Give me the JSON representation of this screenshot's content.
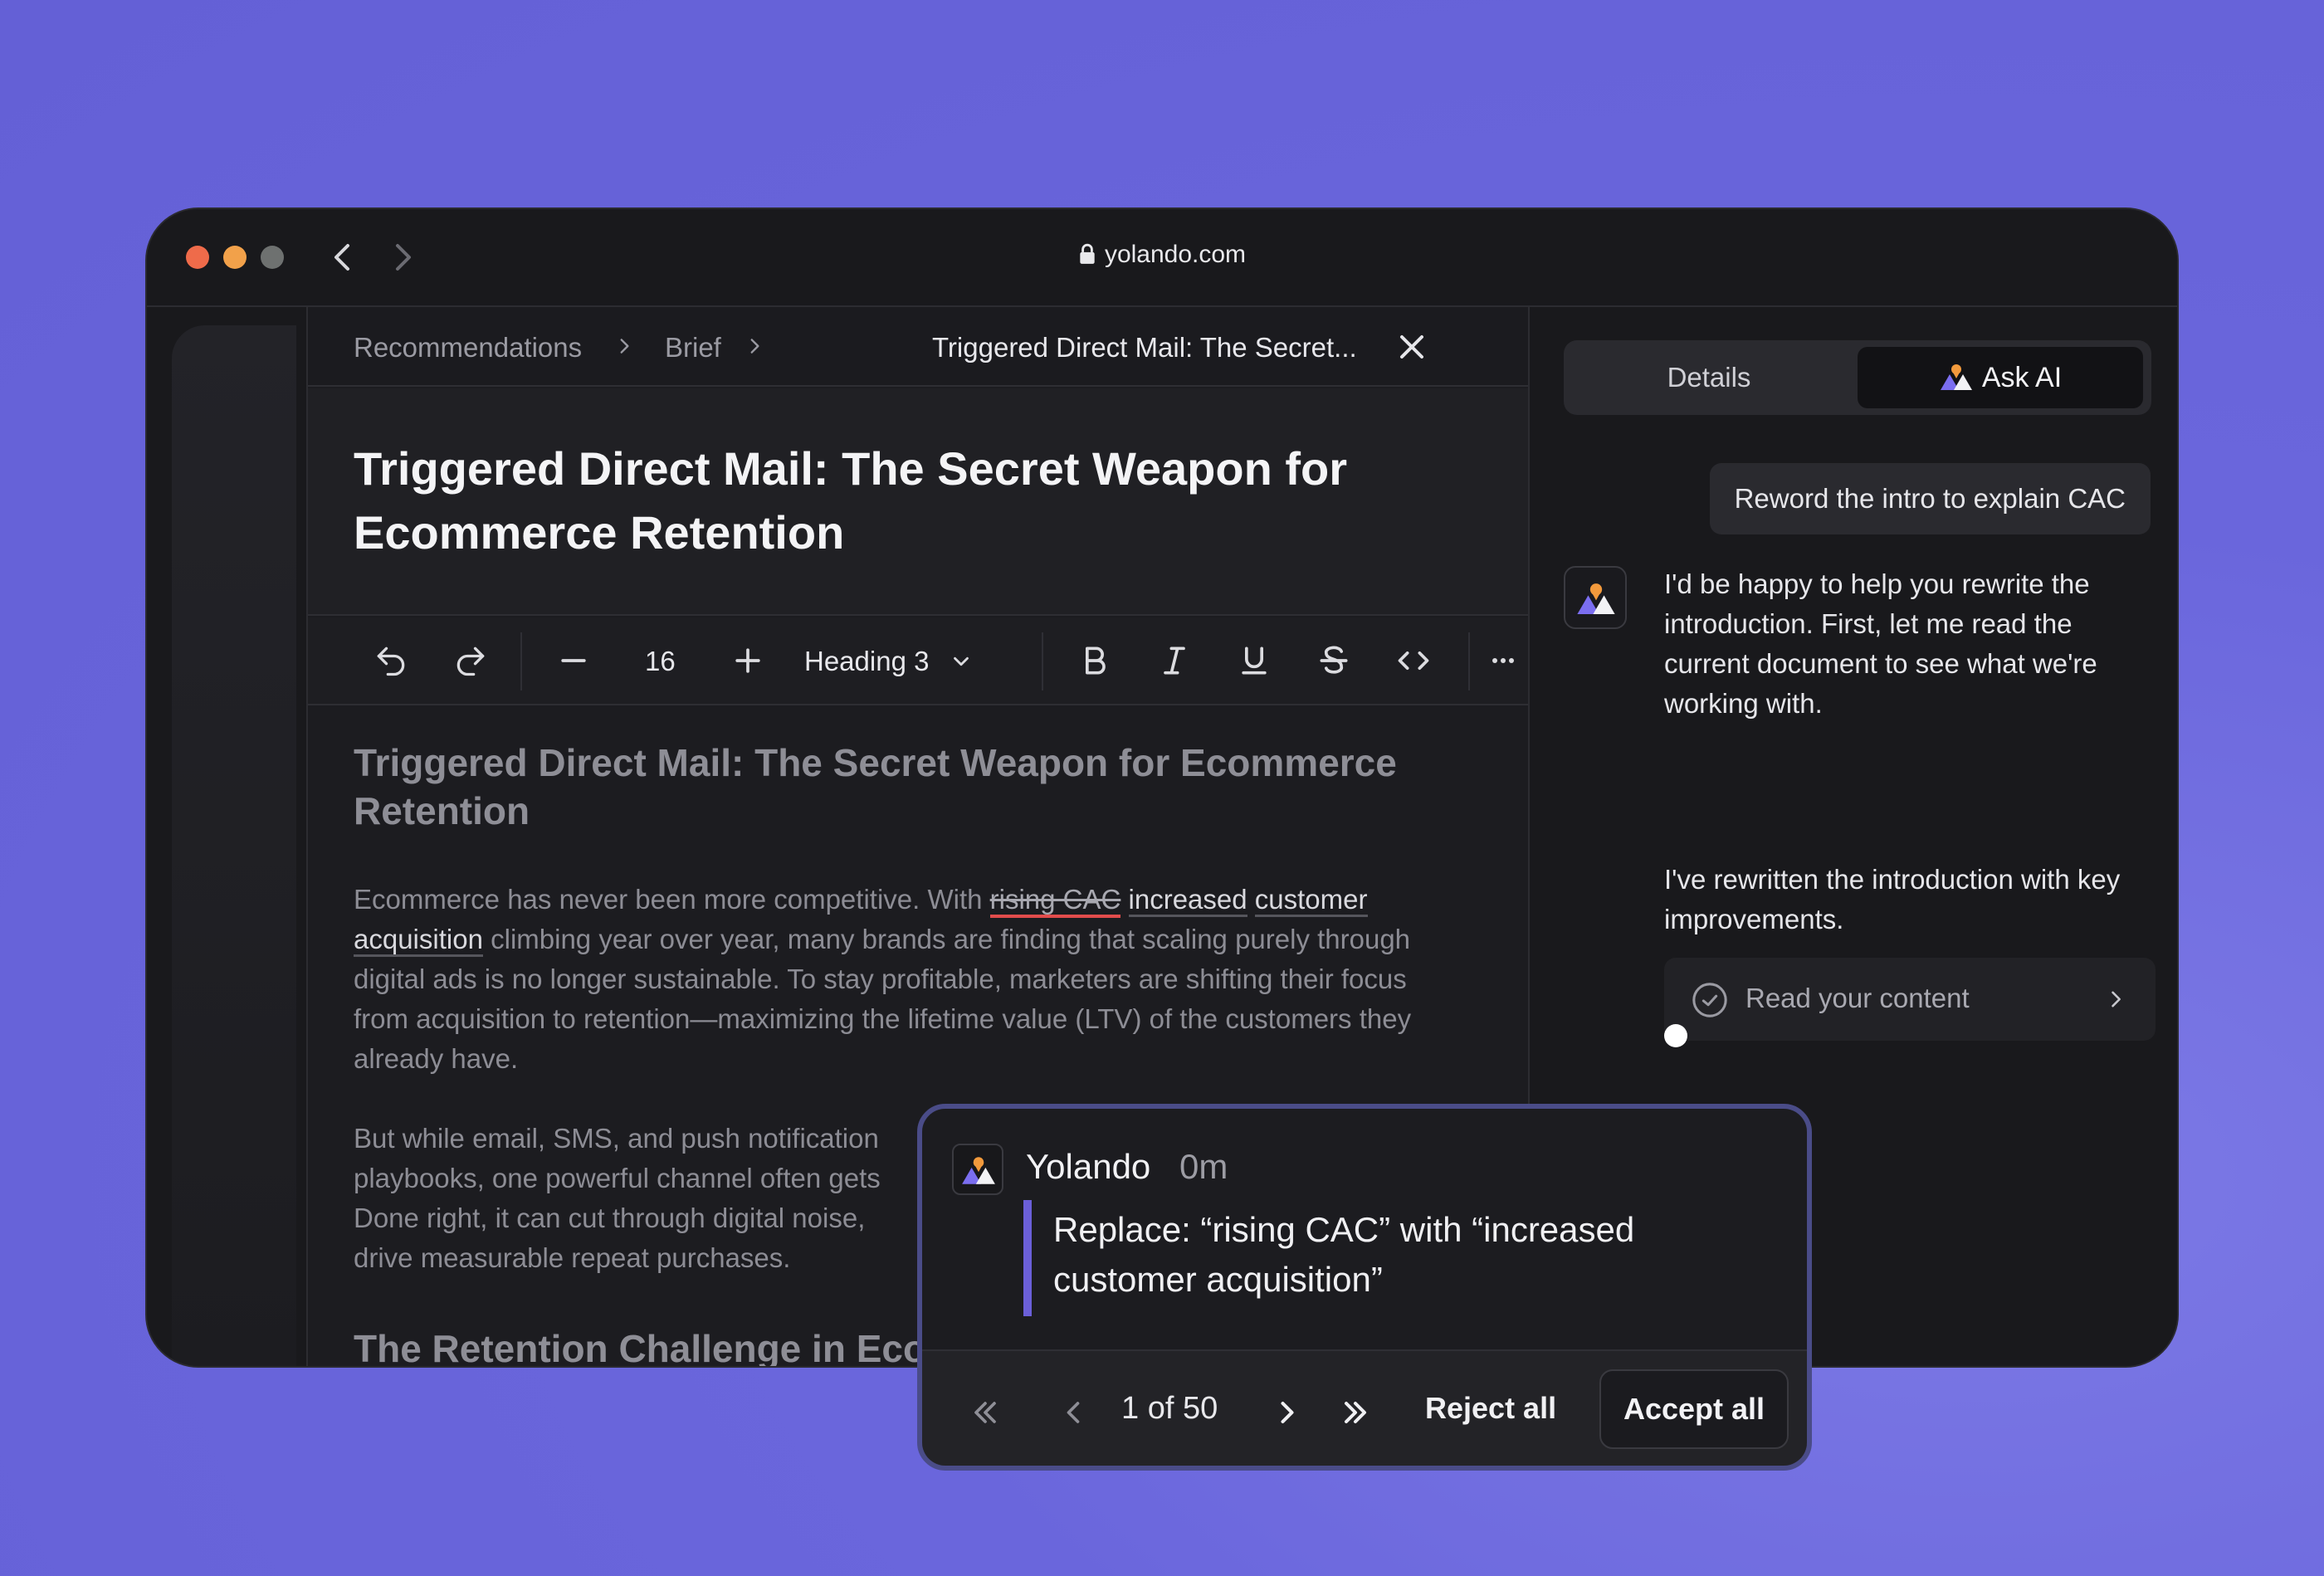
{
  "browser": {
    "url": "yolando.com"
  },
  "breadcrumbs": [
    "Recommendations",
    "Brief",
    "Triggered Direct Mail: The Secret..."
  ],
  "document": {
    "title": "Triggered Direct Mail: The Secret Weapon for Ecommerce Retention",
    "heading": "Triggered Direct Mail: The Secret Weapon for Ecommerce Retention",
    "para1": {
      "pre": "Ecommerce has never been more competitive. With ",
      "deleted": "rising CAC",
      "inserted1": "increased",
      "inserted2": "customer",
      "inserted3": "acquisition",
      "post": " climbing year over year, many brands are finding that scaling purely through digital ads is no longer sustainable. To stay profitable, marketers are shifting their focus from acquisition to retention—maximizing the lifetime value (LTV) of the customers they already have."
    },
    "para2_lines": [
      "But while email, SMS, and push notification",
      "playbooks, one powerful channel often gets",
      "Done right, it can cut through digital noise,",
      "drive measurable repeat purchases."
    ],
    "next_heading": "The Retention Challenge in Ecor"
  },
  "toolbar": {
    "font_size": "16",
    "block_style": "Heading 3"
  },
  "panel": {
    "tabs": {
      "details": "Details",
      "ask_ai": "Ask AI"
    },
    "user_message": "Reword the intro to explain CAC",
    "ai_message_1": "I'd be happy to help you rewrite the introduction. First, let me read the current document to see what we're working with.",
    "tool_call": "Read your content",
    "ai_message_2": "I've rewritten the introduction with key improvements."
  },
  "suggestion": {
    "author": "Yolando",
    "time": "0m",
    "message": "Replace: “rising CAC” with “increased customer acquisition”",
    "counter": "1 of 50",
    "reject_label": "Reject all",
    "accept_label": "Accept all"
  },
  "colors": {
    "accent": "#6b5fd8",
    "background": "#6a66dc",
    "deletion": "#e24c4c"
  }
}
